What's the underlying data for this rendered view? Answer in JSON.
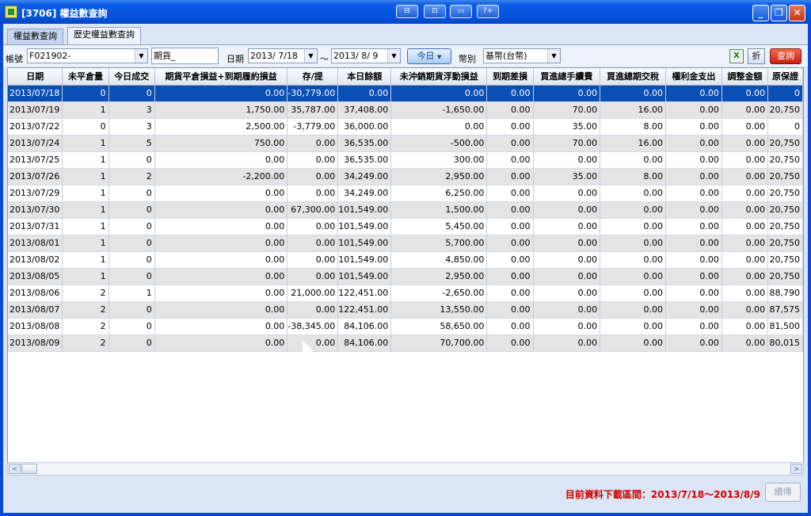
{
  "window": {
    "title": "[3706] 權益數查詢",
    "toolbar_icons": [
      "⊟",
      "⊡",
      "▭",
      "?+"
    ],
    "minimize": "_",
    "maximize": "❐",
    "close": "✕"
  },
  "tabs": [
    {
      "label": "權益數查詢"
    },
    {
      "label": "歷史權益數查詢",
      "active": true
    }
  ],
  "filters": {
    "account_label": "帳號",
    "account_value": "F021902-",
    "product_value": "期貨_",
    "date_label": "日期",
    "date_from": "2013/ 7/18",
    "date_sep": "～",
    "date_to": "2013/ 8/ 9",
    "today_label": "今日",
    "currency_label": "幣別",
    "currency_value": "基幣(台幣)",
    "excel_icon": "X",
    "fold_label": "折",
    "query_label": "查詢"
  },
  "table": {
    "columns": [
      "日期",
      "未平倉量",
      "今日成交",
      "期貨平倉損益+到期履約損益",
      "存/提",
      "本日餘額",
      "未沖銷期貨浮動損益",
      "到期差損",
      "買進總手續費",
      "買進總期交稅",
      "權利金支出",
      "調整金額",
      "原保證"
    ],
    "rows": [
      [
        "2013/07/18",
        "0",
        "0",
        "0.00",
        "-30,779.00",
        "0.00",
        "0.00",
        "0.00",
        "0.00",
        "0.00",
        "0.00",
        "0.00",
        "0"
      ],
      [
        "2013/07/19",
        "1",
        "3",
        "1,750.00",
        "35,787.00",
        "37,408.00",
        "-1,650.00",
        "0.00",
        "70.00",
        "16.00",
        "0.00",
        "0.00",
        "20,750"
      ],
      [
        "2013/07/22",
        "0",
        "3",
        "2,500.00",
        "-3,779.00",
        "36,000.00",
        "0.00",
        "0.00",
        "35.00",
        "8.00",
        "0.00",
        "0.00",
        "0"
      ],
      [
        "2013/07/24",
        "1",
        "5",
        "750.00",
        "0.00",
        "36,535.00",
        "-500.00",
        "0.00",
        "70.00",
        "16.00",
        "0.00",
        "0.00",
        "20,750"
      ],
      [
        "2013/07/25",
        "1",
        "0",
        "0.00",
        "0.00",
        "36,535.00",
        "300.00",
        "0.00",
        "0.00",
        "0.00",
        "0.00",
        "0.00",
        "20,750"
      ],
      [
        "2013/07/26",
        "1",
        "2",
        "-2,200.00",
        "0.00",
        "34,249.00",
        "2,950.00",
        "0.00",
        "35.00",
        "8.00",
        "0.00",
        "0.00",
        "20,750"
      ],
      [
        "2013/07/29",
        "1",
        "0",
        "0.00",
        "0.00",
        "34,249.00",
        "6,250.00",
        "0.00",
        "0.00",
        "0.00",
        "0.00",
        "0.00",
        "20,750"
      ],
      [
        "2013/07/30",
        "1",
        "0",
        "0.00",
        "67,300.00",
        "101,549.00",
        "1,500.00",
        "0.00",
        "0.00",
        "0.00",
        "0.00",
        "0.00",
        "20,750"
      ],
      [
        "2013/07/31",
        "1",
        "0",
        "0.00",
        "0.00",
        "101,549.00",
        "5,450.00",
        "0.00",
        "0.00",
        "0.00",
        "0.00",
        "0.00",
        "20,750"
      ],
      [
        "2013/08/01",
        "1",
        "0",
        "0.00",
        "0.00",
        "101,549.00",
        "5,700.00",
        "0.00",
        "0.00",
        "0.00",
        "0.00",
        "0.00",
        "20,750"
      ],
      [
        "2013/08/02",
        "1",
        "0",
        "0.00",
        "0.00",
        "101,549.00",
        "4,850.00",
        "0.00",
        "0.00",
        "0.00",
        "0.00",
        "0.00",
        "20,750"
      ],
      [
        "2013/08/05",
        "1",
        "0",
        "0.00",
        "0.00",
        "101,549.00",
        "2,950.00",
        "0.00",
        "0.00",
        "0.00",
        "0.00",
        "0.00",
        "20,750"
      ],
      [
        "2013/08/06",
        "2",
        "1",
        "0.00",
        "21,000.00",
        "122,451.00",
        "-2,650.00",
        "0.00",
        "0.00",
        "0.00",
        "0.00",
        "0.00",
        "88,790"
      ],
      [
        "2013/08/07",
        "2",
        "0",
        "0.00",
        "0.00",
        "122,451.00",
        "13,550.00",
        "0.00",
        "0.00",
        "0.00",
        "0.00",
        "0.00",
        "87,575"
      ],
      [
        "2013/08/08",
        "2",
        "0",
        "0.00",
        "-38,345.00",
        "84,106.00",
        "58,650.00",
        "0.00",
        "0.00",
        "0.00",
        "0.00",
        "0.00",
        "81,500"
      ],
      [
        "2013/08/09",
        "2",
        "0",
        "0.00",
        "0.00",
        "84,106.00",
        "70,700.00",
        "0.00",
        "0.00",
        "0.00",
        "0.00",
        "0.00",
        "80,015"
      ]
    ],
    "selected_row": 0
  },
  "scrollbar": {
    "left": "<",
    "right": ">"
  },
  "status": {
    "text": "目前資料下載區間：2013/7/18～2013/8/9",
    "continue_label": "續傳"
  }
}
